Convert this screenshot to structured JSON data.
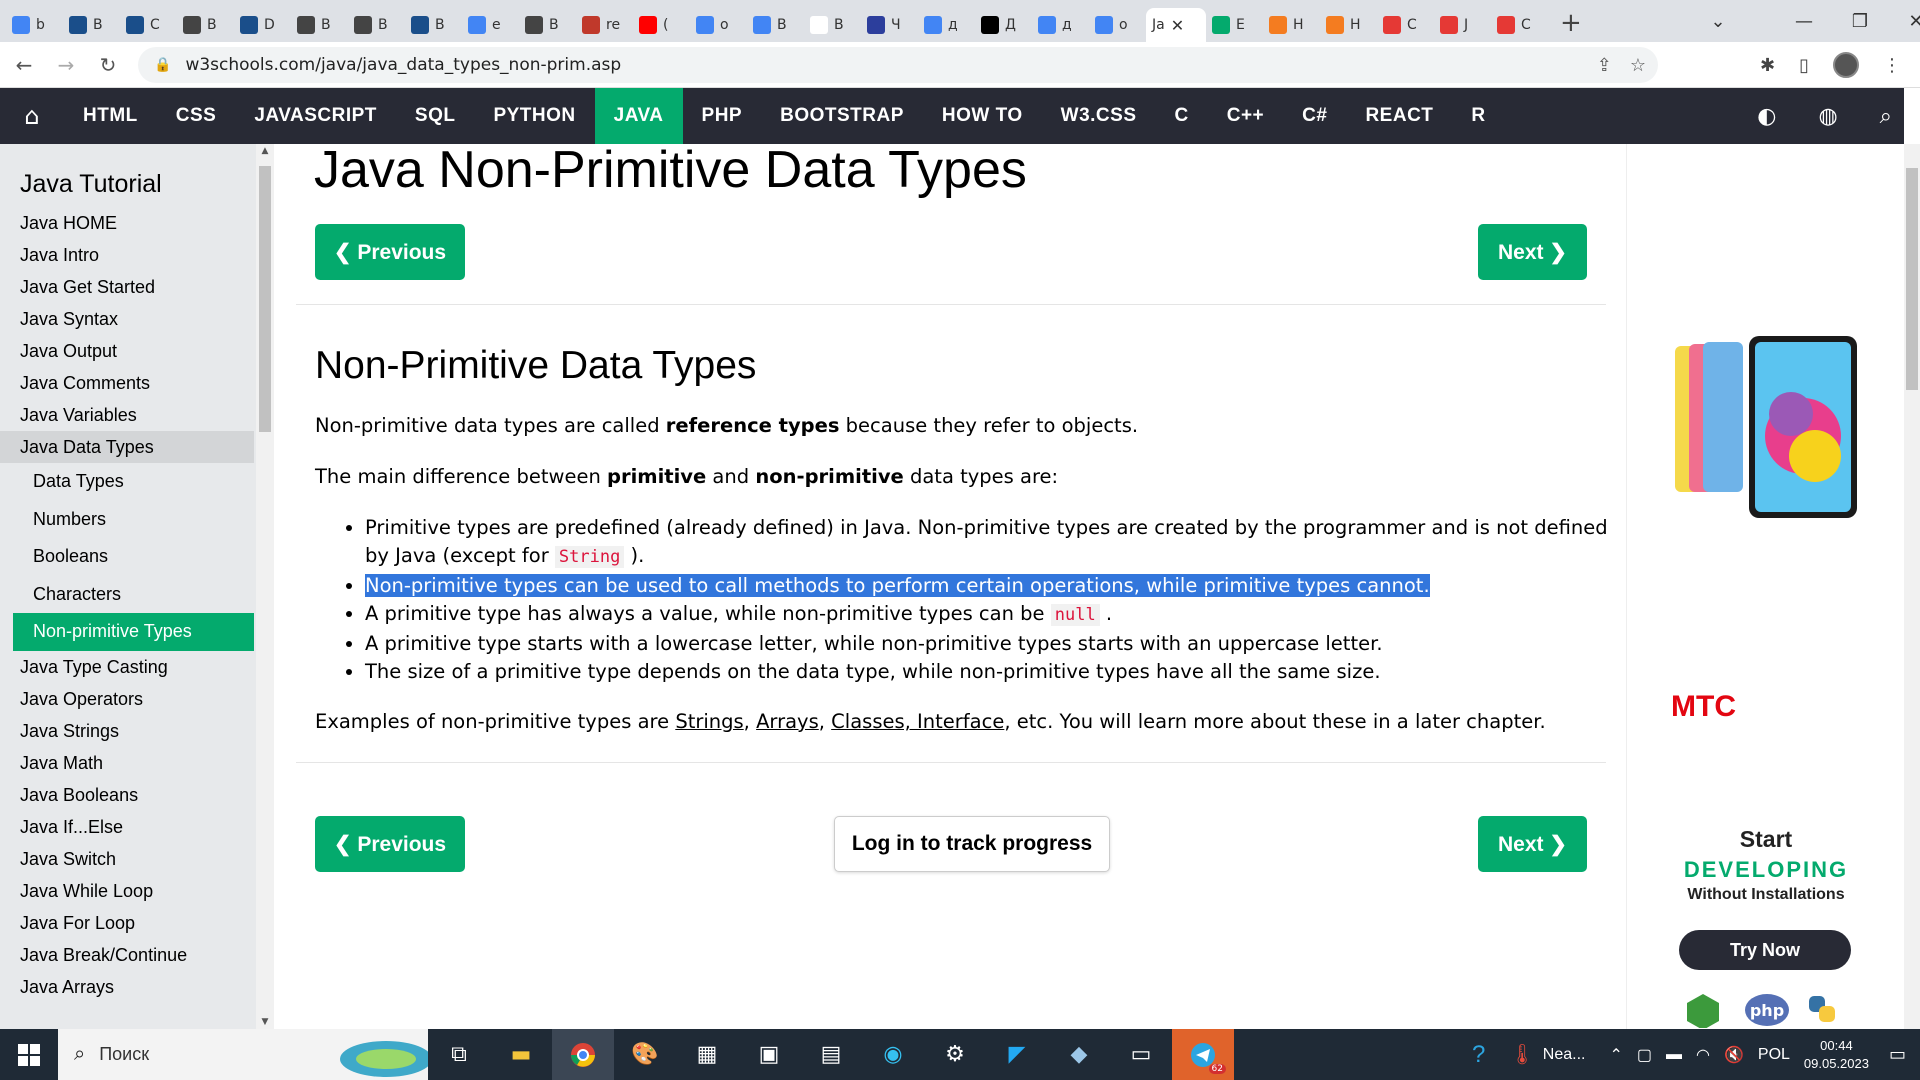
{
  "browser": {
    "tabs": [
      {
        "icon": "google-icon",
        "letter": "b",
        "color": "#4285f4"
      },
      {
        "icon": "group-icon",
        "letter": "B",
        "color": "#1a4e8a"
      },
      {
        "icon": "group-icon",
        "letter": "C",
        "color": "#1a4e8a"
      },
      {
        "icon": "globe-icon",
        "letter": "B",
        "color": "#444"
      },
      {
        "icon": "group-icon",
        "letter": "D",
        "color": "#1a4e8a"
      },
      {
        "icon": "globe-icon",
        "letter": "B",
        "color": "#444"
      },
      {
        "icon": "globe-icon",
        "letter": "B",
        "color": "#444"
      },
      {
        "icon": "group-icon",
        "letter": "B",
        "color": "#1a4e8a"
      },
      {
        "icon": "google-icon",
        "letter": "e",
        "color": "#4285f4"
      },
      {
        "icon": "globe-icon",
        "letter": "B",
        "color": "#444"
      },
      {
        "icon": "react-icon",
        "letter": "re",
        "color": "#c0392b"
      },
      {
        "icon": "youtube-icon",
        "letter": "(",
        "color": "#ff0000"
      },
      {
        "icon": "google-icon",
        "letter": "o",
        "color": "#4285f4"
      },
      {
        "icon": "google-icon",
        "letter": "B",
        "color": "#4285f4"
      },
      {
        "icon": "wikipedia-icon",
        "letter": "B",
        "color": "#fff"
      },
      {
        "icon": "chart-icon",
        "letter": "Ч",
        "color": "#2c3e9c"
      },
      {
        "icon": "google-icon",
        "letter": "д",
        "color": "#4285f4"
      },
      {
        "icon": "investing-icon",
        "letter": "Д",
        "color": "#000"
      },
      {
        "icon": "google-icon",
        "letter": "д",
        "color": "#4285f4"
      },
      {
        "icon": "google-icon",
        "letter": "o",
        "color": "#4285f4"
      }
    ],
    "active_tab": {
      "label": "Ja",
      "close": "✕"
    },
    "tabs_after": [
      {
        "icon": "w3schools-icon",
        "letter": "E",
        "color": "#04aa6d"
      },
      {
        "icon": "habr-icon",
        "letter": "H",
        "color": "#f47c20"
      },
      {
        "icon": "habr-icon",
        "letter": "H",
        "color": "#f47c20"
      },
      {
        "icon": "opera-icon",
        "letter": "C",
        "color": "#e53935"
      },
      {
        "icon": "opera-icon",
        "letter": "J",
        "color": "#e53935"
      },
      {
        "icon": "opera-icon",
        "letter": "C",
        "color": "#e53935"
      }
    ],
    "new_tab": "+",
    "url": "w3schools.com/java/java_data_types_non-prim.asp"
  },
  "topnav": {
    "items": [
      "HTML",
      "CSS",
      "JAVASCRIPT",
      "SQL",
      "PYTHON",
      "JAVA",
      "PHP",
      "BOOTSTRAP",
      "HOW TO",
      "W3.CSS",
      "C",
      "C++",
      "C#",
      "REACT",
      "R"
    ],
    "active": "JAVA"
  },
  "sidebar": {
    "title": "Java Tutorial",
    "items_top": [
      "Java HOME",
      "Java Intro",
      "Java Get Started",
      "Java Syntax",
      "Java Output",
      "Java Comments",
      "Java Variables"
    ],
    "group": "Java Data Types",
    "sub_items": [
      "Data Types",
      "Numbers",
      "Booleans",
      "Characters",
      "Non-primitive Types"
    ],
    "active_sub": "Non-primitive Types",
    "items_bottom": [
      "Java Type Casting",
      "Java Operators",
      "Java Strings",
      "Java Math",
      "Java Booleans",
      "Java If...Else",
      "Java Switch",
      "Java While Loop",
      "Java For Loop",
      "Java Break/Continue",
      "Java Arrays"
    ]
  },
  "main": {
    "title": "Java Non-Primitive Data Types",
    "prev": "❮ Previous",
    "next": "Next ❯",
    "h2": "Non-Primitive Data Types",
    "p1_a": "Non-primitive data types are called ",
    "p1_b": "reference types",
    "p1_c": " because they refer to objects.",
    "p2_a": "The main difference between ",
    "p2_b": "primitive",
    "p2_c": " and ",
    "p2_d": "non-primitive",
    "p2_e": " data types are:",
    "li1_a": "Primitive types are predefined (already defined) in Java. Non-primitive types are created by the programmer and is not defined by Java (except for ",
    "li1_code": "String",
    "li1_b": " ).",
    "li2": "Non-primitive types can be used to call methods to perform certain operations, while primitive types cannot.",
    "li3_a": "A primitive type has always a value, while non-primitive types can be ",
    "li3_code": "null",
    "li3_b": " .",
    "li4": "A primitive type starts with a lowercase letter, while non-primitive types starts with an uppercase letter.",
    "li5": "The size of a primitive type depends on the data type, while non-primitive types have all the same size.",
    "p3_a": "Examples of non-primitive types are ",
    "link_strings": "Strings",
    "comma1": ", ",
    "link_arrays": "Arrays",
    "comma2": ", ",
    "link_classes": "Classes, Interface",
    "p3_b": ", etc. You will learn more about these in a later chapter.",
    "log_in": "Log in to track progress"
  },
  "ads": {
    "mts": "МТС",
    "start": "Start",
    "developing": "DEVELOPING",
    "without": "Without Installations",
    "try_now": "Try Now",
    "php": "php"
  },
  "taskbar": {
    "search": "Поиск",
    "weather": "Nea...",
    "lang": "POL",
    "time": "00:44",
    "date": "09.05.2023",
    "telegram_badge": "62"
  }
}
